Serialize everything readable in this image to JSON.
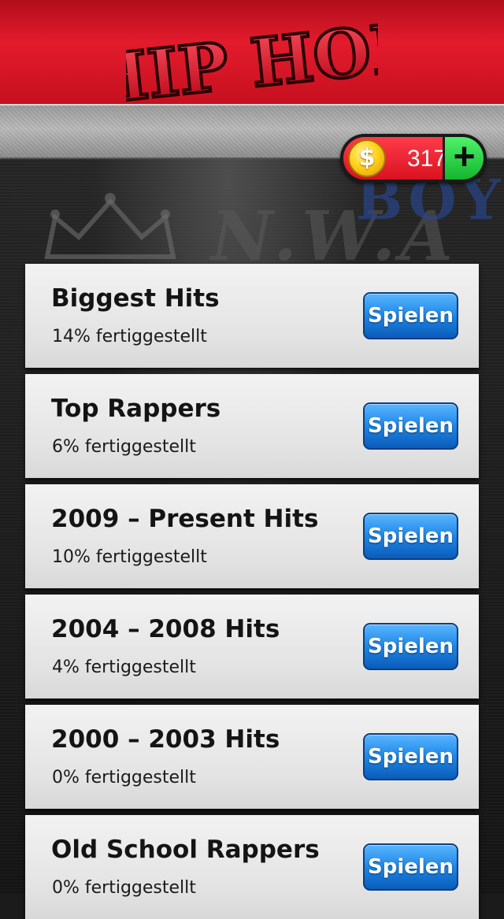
{
  "header": {
    "logo_text": "HIP HOP"
  },
  "coins": {
    "count": "317",
    "coin_symbol": "$",
    "add_symbol": "+"
  },
  "packs": [
    {
      "title": "Biggest Hits",
      "progress": "14% fertiggestellt",
      "button": "Spielen"
    },
    {
      "title": "Top Rappers",
      "progress": "6% fertiggestellt",
      "button": "Spielen"
    },
    {
      "title": "2009 – Present Hits",
      "progress": "10% fertiggestellt",
      "button": "Spielen"
    },
    {
      "title": "2004 – 2008 Hits",
      "progress": "4% fertiggestellt",
      "button": "Spielen"
    },
    {
      "title": "2000 – 2003 Hits",
      "progress": "0% fertiggestellt",
      "button": "Spielen"
    },
    {
      "title": "Old School Rappers",
      "progress": "0% fertiggestellt",
      "button": "Spielen"
    }
  ],
  "background": {
    "nwa_text": "N.W.A",
    "boy_text": "BOY"
  }
}
